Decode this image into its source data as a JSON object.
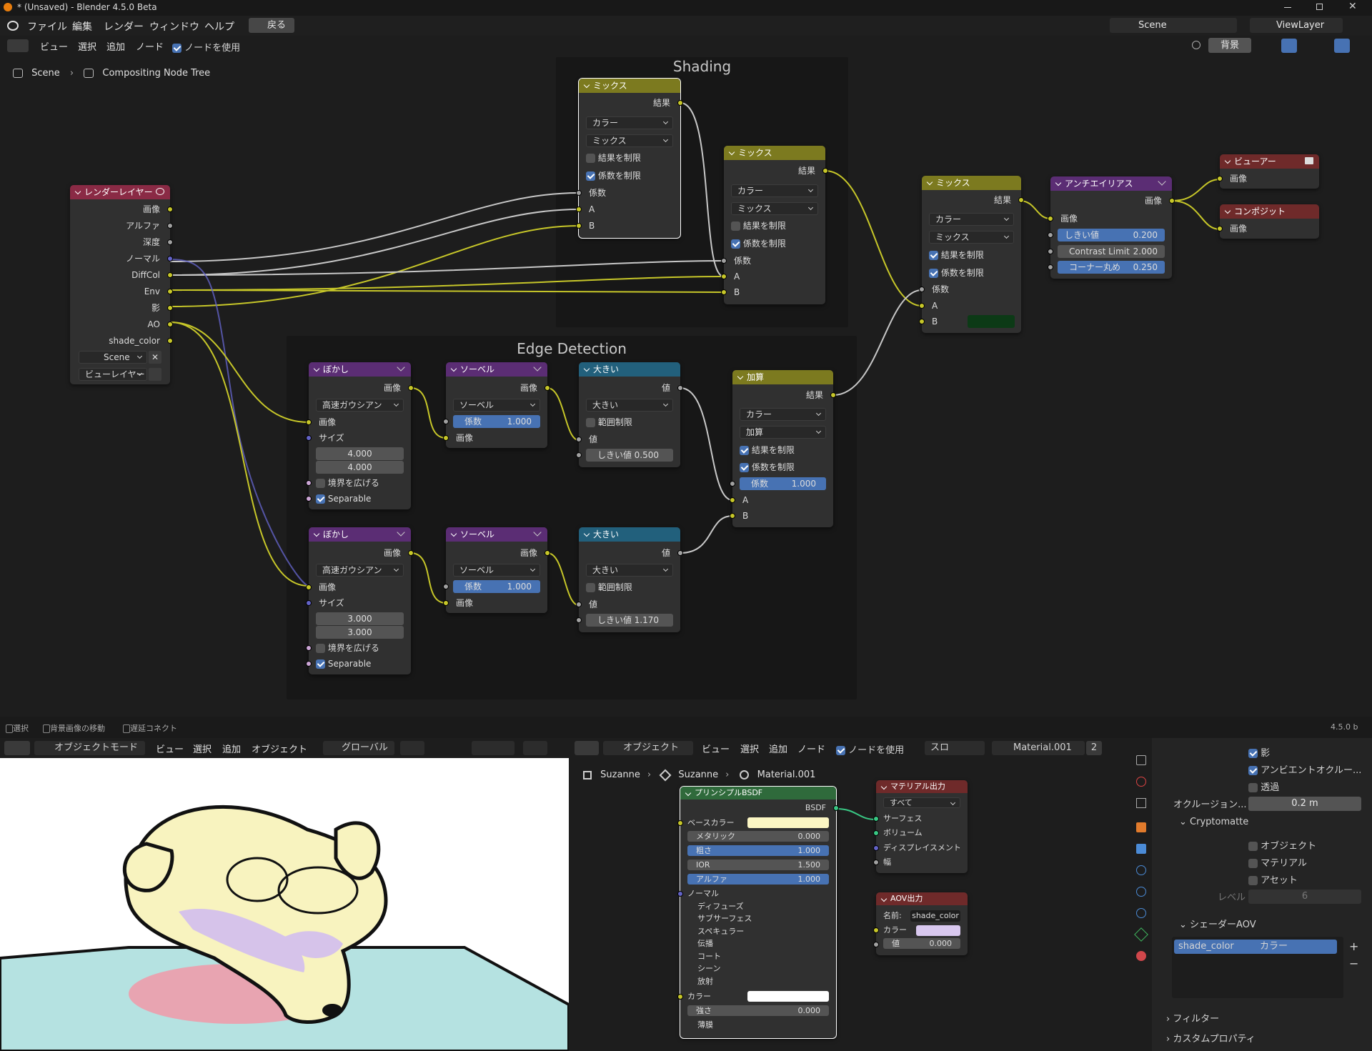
{
  "window": {
    "title": "* (Unsaved) - Blender 4.5.0 Beta"
  },
  "menu": {
    "items": [
      "ファイル",
      "編集",
      "レンダー",
      "ウィンドウ",
      "ヘルプ"
    ],
    "back": "戻る",
    "scene": "Scene",
    "view_layer": "ViewLayer"
  },
  "comp_header": {
    "view": "ビュー",
    "select": "選択",
    "add": "追加",
    "node": "ノード",
    "use_nodes": "ノードを使用",
    "backdrop": "背景"
  },
  "breadcrumb": {
    "scene": "Scene",
    "tree": "Compositing Node Tree"
  },
  "frames": {
    "shading": "Shading",
    "edge": "Edge Detection"
  },
  "render_layers": {
    "title": "レンダーレイヤー",
    "outputs": [
      "画像",
      "アルファ",
      "深度",
      "ノーマル",
      "DiffCol",
      "Env",
      "影",
      "AO",
      "shade_color"
    ],
    "scene": "Scene",
    "layer": "ビューレイヤー"
  },
  "mix1": {
    "title": "ミックス",
    "result": "結果",
    "type": "カラー",
    "blend": "ミックス",
    "clamp_result": "結果を制限",
    "clamp_factor": "係数を制限",
    "fac": "係数",
    "a": "A",
    "b": "B"
  },
  "mix2": {
    "title": "ミックス",
    "result": "結果",
    "type": "カラー",
    "blend": "ミックス",
    "clamp_result": "結果を制限",
    "clamp_factor": "係数を制限",
    "fac": "係数",
    "a": "A",
    "b": "B"
  },
  "mix3": {
    "title": "ミックス",
    "result": "結果",
    "type": "カラー",
    "blend": "ミックス",
    "clamp_result": "結果を制限",
    "clamp_factor": "係数を制限",
    "fac": "係数",
    "a": "A",
    "b": "B",
    "b_color": "#0c3a16"
  },
  "aa": {
    "title": "アンチエイリアス",
    "out": "画像",
    "in": "画像",
    "threshold_label": "しきい値",
    "threshold": "0.200",
    "contrast_label": "Contrast Limit",
    "contrast": "2.000",
    "corner_label": "コーナー丸め",
    "corner": "0.250"
  },
  "viewer": {
    "title": "ビューアー",
    "in": "画像"
  },
  "composite": {
    "title": "コンポジット",
    "in": "画像"
  },
  "blur1": {
    "title": "ぼかし",
    "out": "画像",
    "type": "高速ガウシアン",
    "in": "画像",
    "size": "サイズ",
    "x": "4.000",
    "y": "4.000",
    "extend": "境界を広げる",
    "separable": "Separable"
  },
  "blur2": {
    "title": "ぼかし",
    "out": "画像",
    "type": "高速ガウシアン",
    "in": "画像",
    "size": "サイズ",
    "x": "3.000",
    "y": "3.000",
    "extend": "境界を広げる",
    "separable": "Separable"
  },
  "sobel1": {
    "title": "ソーベル",
    "out": "画像",
    "type": "ソーベル",
    "fac_label": "係数",
    "fac": "1.000",
    "in": "画像"
  },
  "sobel2": {
    "title": "ソーベル",
    "out": "画像",
    "type": "ソーベル",
    "fac_label": "係数",
    "fac": "1.000",
    "in": "画像"
  },
  "gt1": {
    "title": "大きい",
    "out": "値",
    "op": "大きい",
    "clamp": "範囲制限",
    "val": "値",
    "thr_label": "しきい値",
    "thr": "0.500"
  },
  "gt2": {
    "title": "大きい",
    "out": "値",
    "op": "大きい",
    "clamp": "範囲制限",
    "val": "値",
    "thr_label": "しきい値",
    "thr": "1.170"
  },
  "add": {
    "title": "加算",
    "result": "結果",
    "type": "カラー",
    "op": "加算",
    "clamp_result": "結果を制限",
    "clamp_factor": "係数を制限",
    "fac_label": "係数",
    "fac": "1.000",
    "a": "A",
    "b": "B"
  },
  "status": {
    "select": "選択",
    "move": "背景画像の移動",
    "lazy": "遅延コネクト",
    "version": "4.5.0 b"
  },
  "viewport": {
    "mode": "オブジェクトモード",
    "view": "ビュー",
    "select": "選択",
    "add": "追加",
    "object": "オブジェクト",
    "global": "グローバル"
  },
  "shader": {
    "mode": "オブジェクト",
    "view": "ビュー",
    "select": "選択",
    "add": "追加",
    "node": "ノード",
    "use_nodes": "ノードを使用",
    "slot": "スロ",
    "material": "Material.001",
    "users": "2",
    "crumb_obj": "Suzanne",
    "crumb_mesh": "Suzanne",
    "crumb_mat": "Material.001"
  },
  "bsdf": {
    "title": "プリンシプルBSDF",
    "out": "BSDF",
    "base": "ベースカラー",
    "base_color": "#fbf6c3",
    "metal_l": "メタリック",
    "metal": "0.000",
    "rough_l": "粗さ",
    "rough": "1.000",
    "ior_l": "IOR",
    "ior": "1.500",
    "alpha_l": "アルファ",
    "alpha": "1.000",
    "normal": "ノーマル",
    "panels": [
      "ディフューズ",
      "サブサーフェス",
      "スペキュラー",
      "伝播",
      "コート",
      "シーン"
    ],
    "emission": "放射",
    "color": "カラー",
    "strength_l": "強さ",
    "strength": "0.000",
    "film": "薄膜"
  },
  "matout": {
    "title": "マテリアル出力",
    "target": "すべて",
    "surface": "サーフェス",
    "volume": "ボリューム",
    "disp": "ディスプレイスメント",
    "thickness": "幅"
  },
  "aov": {
    "title": "AOV出力",
    "name_l": "名前:",
    "name": "shade_color",
    "color": "カラー",
    "color_val": "#d9c8ef",
    "value_l": "値",
    "value": "0.000"
  },
  "props": {
    "shadow": "影",
    "ao": "アンビエントオクルー...",
    "transp": "透過",
    "occl_l": "オクルージョン...",
    "occl": "0.2 m",
    "crypto": "Cryptomatte",
    "object": "オブジェクト",
    "material": "マテリアル",
    "asset": "アセット",
    "level_l": "レベル",
    "level": "6",
    "shader_aov": "シェーダーAOV",
    "aov_name": "shade_color",
    "aov_type": "カラー",
    "filter": "フィルター",
    "custom": "カスタムプロパティ"
  }
}
